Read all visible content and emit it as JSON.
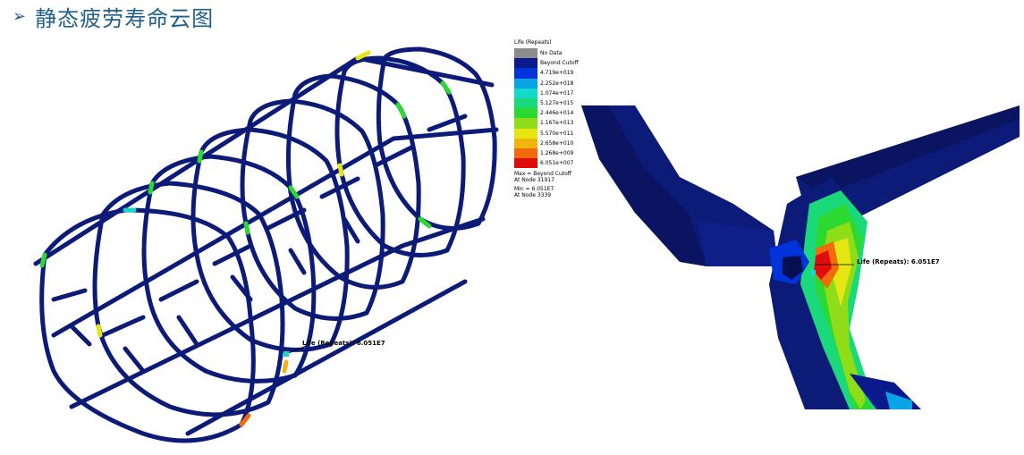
{
  "title": {
    "arrow": "➢",
    "text": "静态疲劳寿命云图"
  },
  "legend": {
    "title": "Life (Repeats)",
    "entries": [
      {
        "color": "#8c8c8c",
        "label": "No Data"
      },
      {
        "color": "#0a1a8c",
        "label": "Beyond Cutoff"
      },
      {
        "color": "#0033d9",
        "label": "4.719e+019"
      },
      {
        "color": "#0aa4e6",
        "label": "2.252e+018"
      },
      {
        "color": "#14d9c8",
        "label": "1.074e+017"
      },
      {
        "color": "#1ad97a",
        "label": "5.127e+015"
      },
      {
        "color": "#2bd930",
        "label": "2.446e+014"
      },
      {
        "color": "#8fdd18",
        "label": "1.167e+013"
      },
      {
        "color": "#e6e612",
        "label": "5.570e+011"
      },
      {
        "color": "#f2b30a",
        "label": "2.658e+010"
      },
      {
        "color": "#f26b0a",
        "label": "1.268e+009"
      },
      {
        "color": "#e00d0d",
        "label": "6.051e+007"
      }
    ],
    "max_line1": "Max = Beyond Cutoff",
    "max_line2": "At Node 31917",
    "min_line1": "Min = 6.051E7",
    "min_line2": "At Node 3339"
  },
  "left_annotation": "Life (Repeats): 6.051E7",
  "right_annotation": "Life (Repeats): 6.051E7",
  "colors": {
    "tube": "#0c1a78",
    "tube_edge": "#061050",
    "title": "#1f5f8b"
  }
}
